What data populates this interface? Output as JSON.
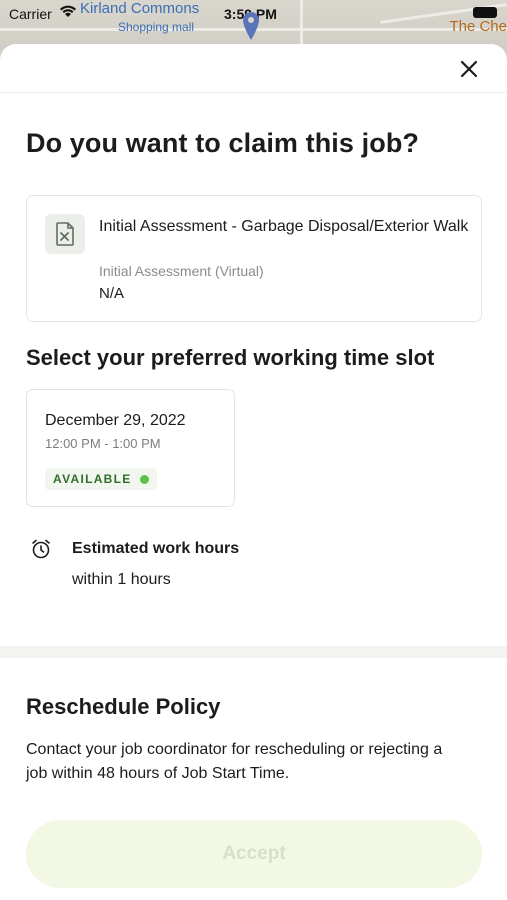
{
  "status_bar": {
    "carrier": "Carrier",
    "time": "3:59 PM"
  },
  "map": {
    "place_name": "Kirland Commons",
    "place_sub": "Shopping mall",
    "right_label": "The Che"
  },
  "modal": {
    "title": "Do you want to claim this job?",
    "job": {
      "title": "Initial Assessment - Garbage Disposal/Exterior Walk",
      "type": "Initial Assessment (Virtual)",
      "extra": "N/A"
    },
    "time_slot_section": {
      "title": "Select your preferred working time slot",
      "slots": [
        {
          "date": "December 29, 2022",
          "time": "12:00 PM - 1:00 PM",
          "status": "AVAILABLE",
          "status_color": "#5cc148"
        }
      ]
    },
    "estimated": {
      "label": "Estimated work hours",
      "value": "within 1 hours"
    },
    "policy": {
      "title": "Reschedule Policy",
      "text": "Contact your job coordinator for rescheduling or rejecting a job within 48 hours of Job Start Time."
    },
    "accept_button": {
      "label": "Accept",
      "enabled": false
    }
  },
  "colors": {
    "accent_green": "#5cc148",
    "disabled_button_bg": "#f2f8e4",
    "disabled_button_text": "#d7dfc9"
  }
}
